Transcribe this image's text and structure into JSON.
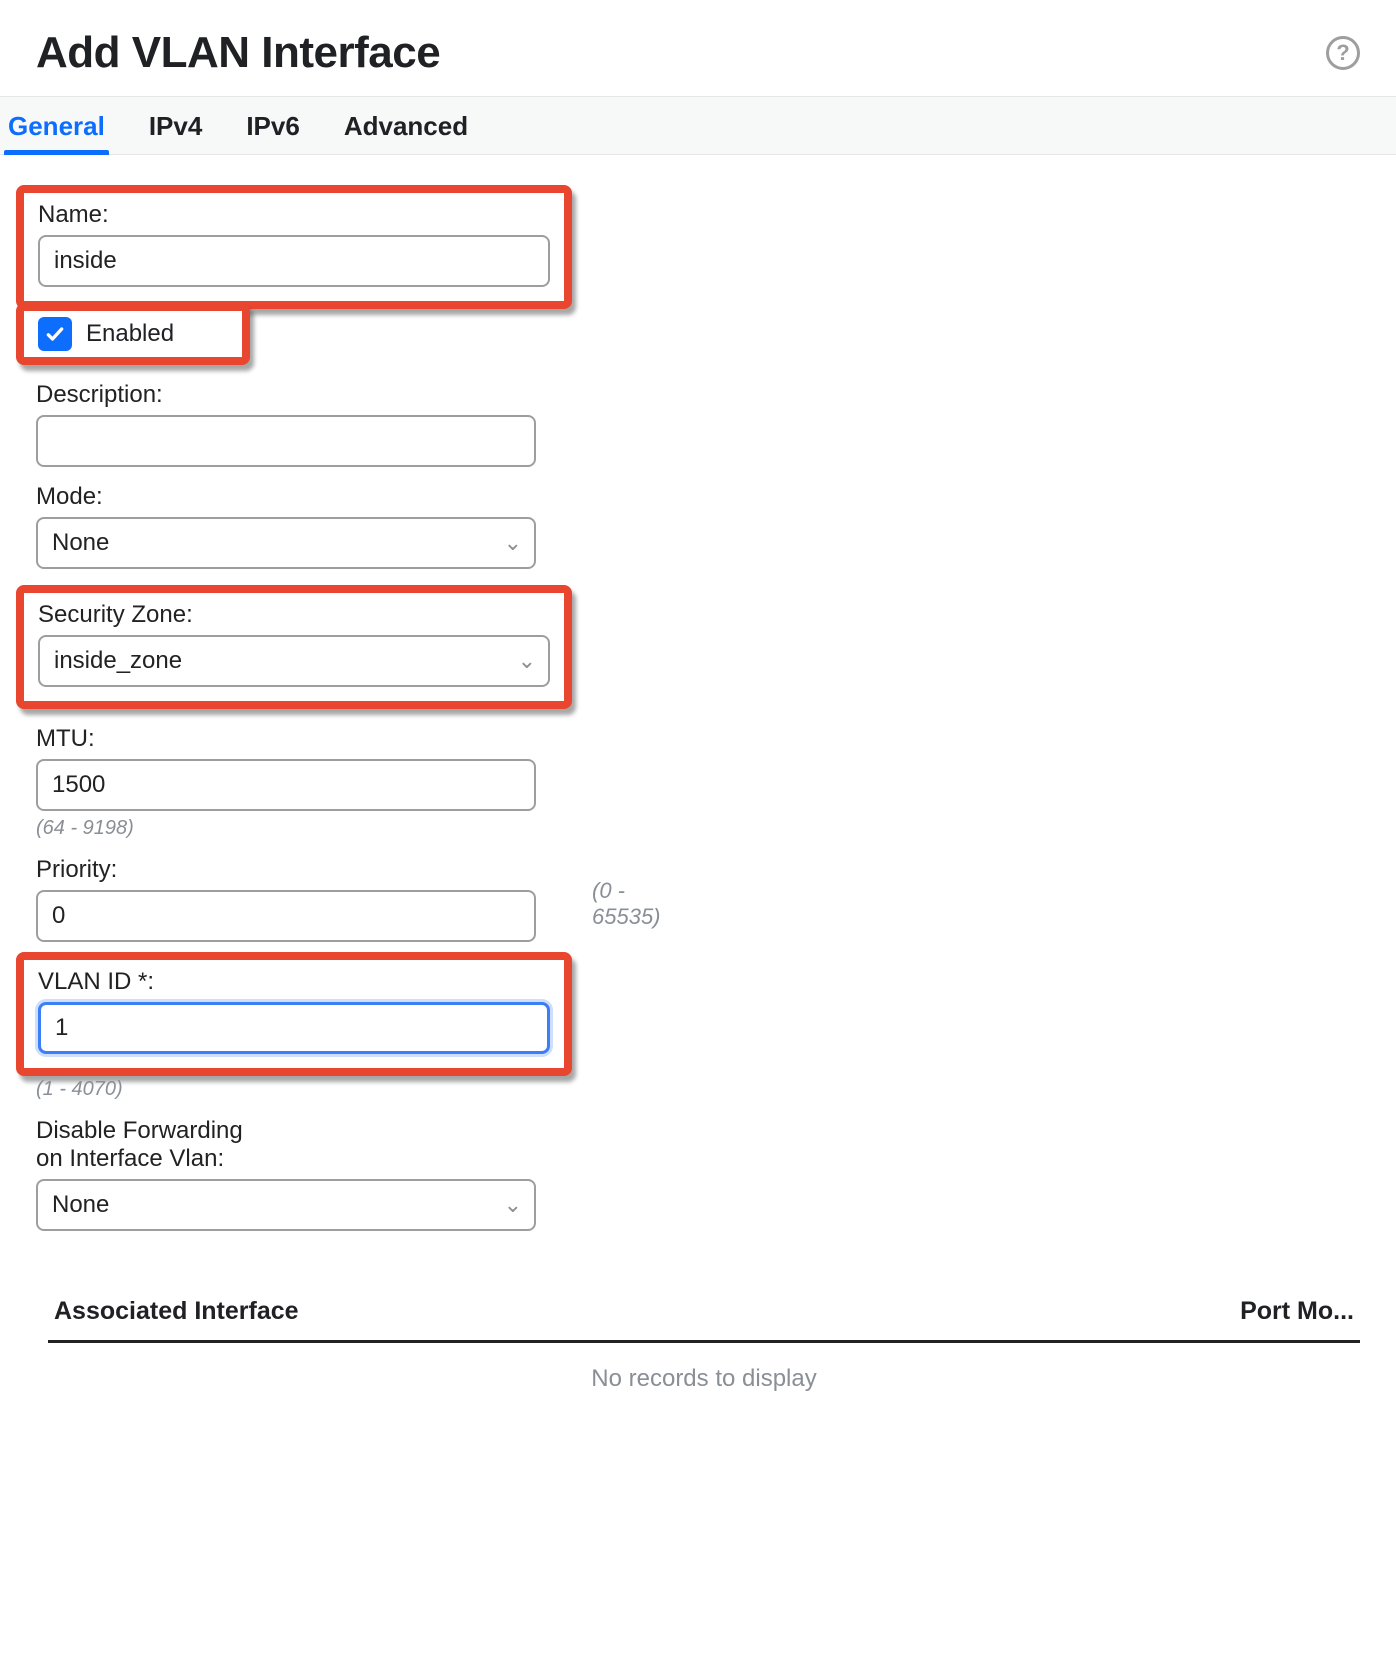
{
  "header": {
    "title": "Add VLAN Interface",
    "help": "?"
  },
  "tabs": [
    {
      "label": "General",
      "active": true
    },
    {
      "label": "IPv4",
      "active": false
    },
    {
      "label": "IPv6",
      "active": false
    },
    {
      "label": "Advanced",
      "active": false
    }
  ],
  "fields": {
    "name": {
      "label": "Name:",
      "value": "inside"
    },
    "enabled": {
      "label": "Enabled",
      "checked": true
    },
    "description": {
      "label": "Description:",
      "value": ""
    },
    "mode": {
      "label": "Mode:",
      "value": "None"
    },
    "security_zone": {
      "label": "Security Zone:",
      "value": "inside_zone"
    },
    "mtu": {
      "label": "MTU:",
      "value": "1500",
      "range": "(64 - 9198)"
    },
    "priority": {
      "label": "Priority:",
      "value": "0",
      "range": "(0 - 65535)"
    },
    "vlan_id": {
      "label": "VLAN ID *:",
      "value": "1",
      "range": "(1 - 4070)"
    },
    "disable_forward": {
      "label_line1": "Disable Forwarding",
      "label_line2": "on Interface Vlan:",
      "value": "None"
    }
  },
  "table": {
    "col1": "Associated Interface",
    "col2": "Port Mo...",
    "empty": "No records to display"
  }
}
